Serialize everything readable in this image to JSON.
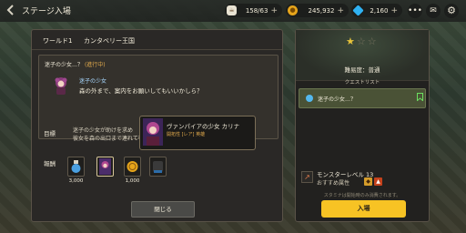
{
  "topbar": {
    "title": "ステージ入場",
    "stamina": "158/63",
    "gold": "245,932",
    "gems": "2,160",
    "plus": "+",
    "stamina_icon": "coffee-cup-icon",
    "gold_icon": "coin-icon",
    "gem_icon": "diamond-icon"
  },
  "main": {
    "world_label": "ワールド1",
    "world_name": "カンタベリー王国",
    "quest_title": "迷子の少女…？",
    "quest_status": "(進行中)",
    "speaker": "迷子の少女",
    "dialog": "森の外まで、案内をお願いしてもいいかしら？",
    "goal_label": "目標",
    "goal_text_1": "迷子の少女が助けを求め",
    "goal_text_2": "彼女を森の出口まで連れて行",
    "reward_label": "報酬",
    "rewards": [
      {
        "qty": "3,000"
      },
      {
        "qty": ""
      },
      {
        "qty": "1,000"
      },
      {
        "qty": ""
      }
    ],
    "close_label": "閉じる"
  },
  "tooltip": {
    "name": "ヴァンパイアの少女 カリナ",
    "info": "開拓性 [レア] 英雄"
  },
  "side": {
    "stars_filled": 1,
    "stars_total": 3,
    "difficulty": "難易度：普通",
    "quest_list_header": "クエストリスト",
    "quest_entry": "迷子の少女…？",
    "monster_level_label": "モンスターレベル",
    "monster_level": "13",
    "attr_label": "おすすめ属性",
    "note": "スタミナは開始時のみ消費されます。",
    "enter_label": "入場"
  },
  "colors": {
    "accent_yellow": "#f7c324",
    "quest_highlight": "#4a5236",
    "status_orange": "#e0a94c"
  }
}
